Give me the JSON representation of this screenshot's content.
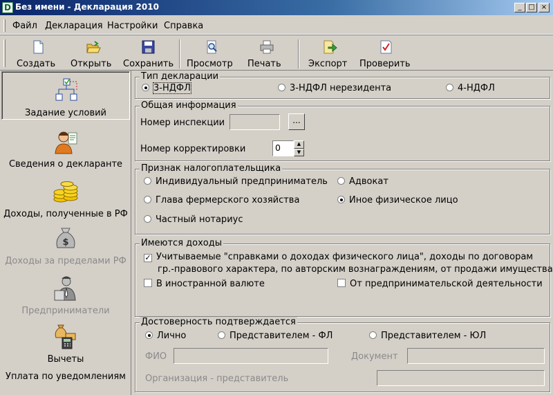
{
  "window": {
    "title": "Без имени - Декларация 2010"
  },
  "menu": [
    "Файл",
    "Декларация",
    "Настройки",
    "Справка"
  ],
  "toolbar": {
    "create": "Создать",
    "open": "Открыть",
    "save": "Сохранить",
    "preview": "Просмотр",
    "print": "Печать",
    "export": "Экспорт",
    "check": "Проверить"
  },
  "nav": {
    "conditions": "Задание условий",
    "declarant": "Сведения о декларанте",
    "income_rf": "Доходы, полученные в РФ",
    "income_abroad": "Доходы за пределами РФ",
    "entrepreneurs": "Предприниматели",
    "deductions": "Вычеты",
    "notification_payment": "Уплата по уведомлениям"
  },
  "declaration_type": {
    "title": "Тип декларации",
    "options": [
      "3-НДФЛ",
      "3-НДФЛ нерезидента",
      "4-НДФЛ"
    ],
    "selected": 0
  },
  "general_info": {
    "title": "Общая информация",
    "inspection_label": "Номер инспекции",
    "inspection_value": "",
    "browse_label": "...",
    "correction_label": "Номер корректировки",
    "correction_value": "0"
  },
  "taxpayer": {
    "title": "Признак налогоплательщика",
    "options": [
      "Индивидуальный предприниматель",
      "Адвокат",
      "Глава фермерского хозяйства",
      "Иное физическое лицо",
      "Частный нотариус"
    ],
    "selected": 3
  },
  "income": {
    "title": "Имеются доходы",
    "opt1_line1": "Учитываемые \"справками о доходах физического лица\", доходы по договорам",
    "opt1_line2": "гр.-правового характера, по авторским вознаграждениям, от продажи имущества и др.",
    "opt1_checked": true,
    "opt2": "В иностранной валюте",
    "opt2_checked": false,
    "opt3": "От предпринимательской деятельности",
    "opt3_checked": false
  },
  "reliability": {
    "title": "Достоверность подтверждается",
    "options": [
      "Лично",
      "Представителем - ФЛ",
      "Представителем - ЮЛ"
    ],
    "selected": 0,
    "fio_label": "ФИО",
    "document_label": "Документ",
    "org_label": "Организация - представитель"
  },
  "colors": {
    "titlebar_start": "#0a246a",
    "titlebar_end": "#a6caf0",
    "face": "#d4d0c8"
  }
}
